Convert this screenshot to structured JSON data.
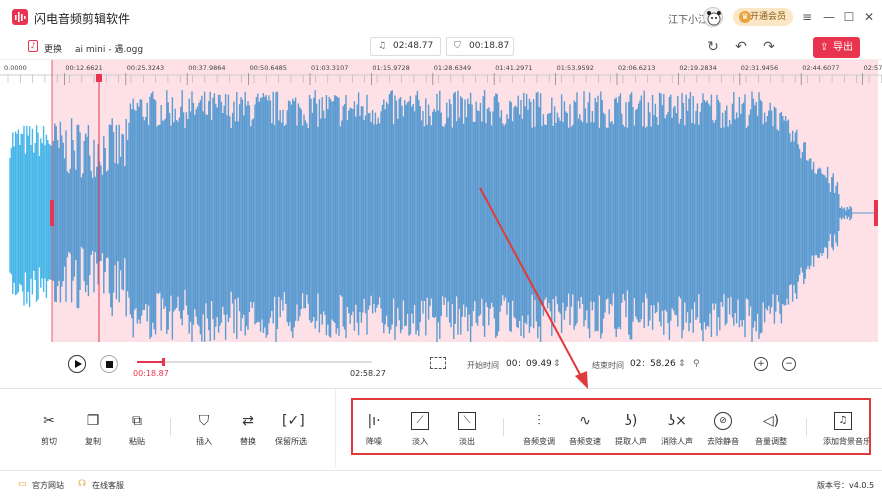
{
  "app": {
    "title": "闪电音频剪辑软件",
    "user_name": "江下小江",
    "vip_label": "开通会员",
    "vip_icon": "crown-icon",
    "window_controls": [
      "≡",
      "—",
      "☐",
      "✕"
    ]
  },
  "filebar": {
    "replace_label": "更换",
    "file_name": "ai mini - 遇.ogg",
    "total_duration": "02:48.77",
    "selected_duration": "00:18.87",
    "export_label": "导出"
  },
  "timeline": {
    "tick_labels": [
      "0.0000",
      "00:12.6621",
      "00:25.3243",
      "00:37.9864",
      "00:50.6485",
      "01:03.3107",
      "01:15.9728",
      "01:28.6349",
      "01:41.2971",
      "01:53.9592",
      "02:06.6213",
      "02:19.2834",
      "02:31.9456",
      "02:44.6077",
      "02:57.2"
    ]
  },
  "playback": {
    "current_time": "00:18.87",
    "end_time": "02:58.27",
    "progress_fraction": 0.11
  },
  "range": {
    "start_label": "开始时间",
    "start_min": "00",
    "start_sec": "09.49",
    "end_label": "结束时间",
    "end_min": "02",
    "end_sec": "58.26"
  },
  "toolbar": {
    "basic": [
      {
        "label": "剪切",
        "icon": "scissors-icon"
      },
      {
        "label": "复制",
        "icon": "copy-icon"
      },
      {
        "label": "粘贴",
        "icon": "paste-icon"
      },
      {
        "label": "插入",
        "icon": "insert-icon"
      },
      {
        "label": "替换",
        "icon": "swap-icon"
      },
      {
        "label": "保留所选",
        "icon": "keep-selection-icon"
      }
    ],
    "effects": [
      {
        "label": "降噪",
        "icon": "denoise-icon"
      },
      {
        "label": "淡入",
        "icon": "fade-in-icon"
      },
      {
        "label": "淡出",
        "icon": "fade-out-icon"
      },
      {
        "label": "音频变调",
        "icon": "pitch-icon"
      },
      {
        "label": "音频变速",
        "icon": "speed-icon"
      },
      {
        "label": "提取人声",
        "icon": "extract-voice-icon"
      },
      {
        "label": "消除人声",
        "icon": "remove-voice-icon"
      },
      {
        "label": "去除静音",
        "icon": "remove-silence-icon"
      },
      {
        "label": "音量调整",
        "icon": "volume-icon"
      },
      {
        "label": "添加背景音乐",
        "icon": "background-music-icon"
      }
    ]
  },
  "statusbar": {
    "website_label": "官方网站",
    "support_label": "在线客服",
    "version_label": "版本号：v4.0.5"
  },
  "colors": {
    "accent": "#e8344e",
    "wave_main": "#5b9bd1",
    "wave_left": "#48b6e8",
    "selection_bg": "#fde1e6",
    "highlight_box": "#e13a3a",
    "arrow": "#e13a3a"
  }
}
